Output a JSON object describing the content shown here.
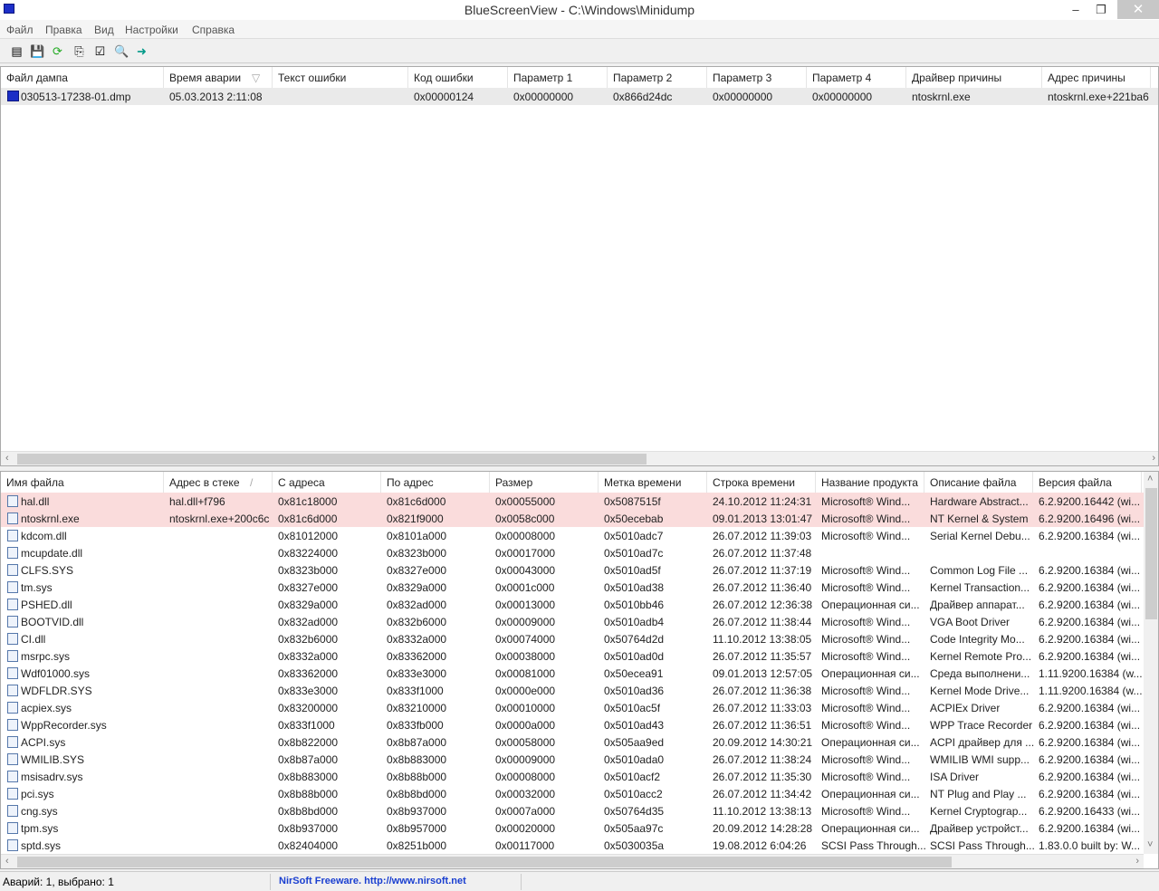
{
  "window": {
    "title": "BlueScreenView  -  C:\\Windows\\Minidump",
    "minimize": "‒",
    "maximize": "❐",
    "close": "✕"
  },
  "menu": [
    "Файл",
    "Правка",
    "Вид",
    "Настройки",
    "Справка"
  ],
  "toolbar": [
    "properties-icon",
    "save-icon",
    "refresh-icon",
    "copy-icon",
    "options-icon",
    "find-icon",
    "exit-icon"
  ],
  "dumps": {
    "columns": [
      "Файл дампа",
      "Время аварии",
      "Текст ошибки",
      "Код ошибки",
      "Параметр 1",
      "Параметр 2",
      "Параметр 3",
      "Параметр 4",
      "Драйвер причины",
      "Адрес причины"
    ],
    "rows": [
      [
        "030513-17238-01.dmp",
        "05.03.2013 2:11:08",
        "",
        "0x00000124",
        "0x00000000",
        "0x866d24dc",
        "0x00000000",
        "0x00000000",
        "ntoskrnl.exe",
        "ntoskrnl.exe+221ba6"
      ]
    ]
  },
  "drivers": {
    "columns": [
      "Имя файла",
      "Адрес в стеке",
      "С адреса",
      "По адрес",
      "Размер",
      "Метка времени",
      "Строка времени",
      "Название продукта",
      "Описание файла",
      "Версия файла"
    ],
    "rows": [
      [
        "hal.dll",
        "hal.dll+f796",
        "0x81c18000",
        "0x81c6d000",
        "0x00055000",
        "0x5087515f",
        "24.10.2012 11:24:31",
        "Microsoft® Wind...",
        "Hardware Abstract...",
        "6.2.9200.16442 (wi..."
      ],
      [
        "ntoskrnl.exe",
        "ntoskrnl.exe+200c6c",
        "0x81c6d000",
        "0x821f9000",
        "0x0058c000",
        "0x50ecebab",
        "09.01.2013 13:01:47",
        "Microsoft® Wind...",
        "NT Kernel & System",
        "6.2.9200.16496 (wi..."
      ],
      [
        "kdcom.dll",
        "",
        "0x81012000",
        "0x8101a000",
        "0x00008000",
        "0x5010adc7",
        "26.07.2012 11:39:03",
        "Microsoft® Wind...",
        "Serial Kernel Debu...",
        "6.2.9200.16384 (wi..."
      ],
      [
        "mcupdate.dll",
        "",
        "0x83224000",
        "0x8323b000",
        "0x00017000",
        "0x5010ad7c",
        "26.07.2012 11:37:48",
        "",
        "",
        ""
      ],
      [
        "CLFS.SYS",
        "",
        "0x8323b000",
        "0x8327e000",
        "0x00043000",
        "0x5010ad5f",
        "26.07.2012 11:37:19",
        "Microsoft® Wind...",
        "Common Log File ...",
        "6.2.9200.16384 (wi..."
      ],
      [
        "tm.sys",
        "",
        "0x8327e000",
        "0x8329a000",
        "0x0001c000",
        "0x5010ad38",
        "26.07.2012 11:36:40",
        "Microsoft® Wind...",
        "Kernel Transaction...",
        "6.2.9200.16384 (wi..."
      ],
      [
        "PSHED.dll",
        "",
        "0x8329a000",
        "0x832ad000",
        "0x00013000",
        "0x5010bb46",
        "26.07.2012 12:36:38",
        "Операционная си...",
        "Драйвер аппарат...",
        "6.2.9200.16384 (wi..."
      ],
      [
        "BOOTVID.dll",
        "",
        "0x832ad000",
        "0x832b6000",
        "0x00009000",
        "0x5010adb4",
        "26.07.2012 11:38:44",
        "Microsoft® Wind...",
        "VGA Boot Driver",
        "6.2.9200.16384 (wi..."
      ],
      [
        "CI.dll",
        "",
        "0x832b6000",
        "0x8332a000",
        "0x00074000",
        "0x50764d2d",
        "11.10.2012 13:38:05",
        "Microsoft® Wind...",
        "Code Integrity Mo...",
        "6.2.9200.16384 (wi..."
      ],
      [
        "msrpc.sys",
        "",
        "0x8332a000",
        "0x83362000",
        "0x00038000",
        "0x5010ad0d",
        "26.07.2012 11:35:57",
        "Microsoft® Wind...",
        "Kernel Remote Pro...",
        "6.2.9200.16384 (wi..."
      ],
      [
        "Wdf01000.sys",
        "",
        "0x83362000",
        "0x833e3000",
        "0x00081000",
        "0x50ecea91",
        "09.01.2013 12:57:05",
        "Операционная си...",
        "Среда выполнени...",
        "1.11.9200.16384 (w..."
      ],
      [
        "WDFLDR.SYS",
        "",
        "0x833e3000",
        "0x833f1000",
        "0x0000e000",
        "0x5010ad36",
        "26.07.2012 11:36:38",
        "Microsoft® Wind...",
        "Kernel Mode Drive...",
        "1.11.9200.16384 (w..."
      ],
      [
        "acpiex.sys",
        "",
        "0x83200000",
        "0x83210000",
        "0x00010000",
        "0x5010ac5f",
        "26.07.2012 11:33:03",
        "Microsoft® Wind...",
        "ACPIEx Driver",
        "6.2.9200.16384 (wi..."
      ],
      [
        "WppRecorder.sys",
        "",
        "0x833f1000",
        "0x833fb000",
        "0x0000a000",
        "0x5010ad43",
        "26.07.2012 11:36:51",
        "Microsoft® Wind...",
        "WPP Trace Recorder",
        "6.2.9200.16384 (wi..."
      ],
      [
        "ACPI.sys",
        "",
        "0x8b822000",
        "0x8b87a000",
        "0x00058000",
        "0x505aa9ed",
        "20.09.2012 14:30:21",
        "Операционная си...",
        "ACPI драйвер для ...",
        "6.2.9200.16384 (wi..."
      ],
      [
        "WMILIB.SYS",
        "",
        "0x8b87a000",
        "0x8b883000",
        "0x00009000",
        "0x5010ada0",
        "26.07.2012 11:38:24",
        "Microsoft® Wind...",
        "WMILIB WMI supp...",
        "6.2.9200.16384 (wi..."
      ],
      [
        "msisadrv.sys",
        "",
        "0x8b883000",
        "0x8b88b000",
        "0x00008000",
        "0x5010acf2",
        "26.07.2012 11:35:30",
        "Microsoft® Wind...",
        "ISA Driver",
        "6.2.9200.16384 (wi..."
      ],
      [
        "pci.sys",
        "",
        "0x8b88b000",
        "0x8b8bd000",
        "0x00032000",
        "0x5010acc2",
        "26.07.2012 11:34:42",
        "Операционная си...",
        "NT Plug and Play ...",
        "6.2.9200.16384 (wi..."
      ],
      [
        "cng.sys",
        "",
        "0x8b8bd000",
        "0x8b937000",
        "0x0007a000",
        "0x50764d35",
        "11.10.2012 13:38:13",
        "Microsoft® Wind...",
        "Kernel Cryptograp...",
        "6.2.9200.16433 (wi..."
      ],
      [
        "tpm.sys",
        "",
        "0x8b937000",
        "0x8b957000",
        "0x00020000",
        "0x505aa97c",
        "20.09.2012 14:28:28",
        "Операционная си...",
        "Драйвер устройст...",
        "6.2.9200.16384 (wi..."
      ],
      [
        "sptd.sys",
        "",
        "0x82404000",
        "0x8251b000",
        "0x00117000",
        "0x5030035a",
        "19.08.2012 6:04:26",
        "SCSI Pass Through...",
        "SCSI Pass Through...",
        "1.83.0.0 built by: W..."
      ]
    ]
  },
  "status": {
    "count": "Аварий: 1, выбрано: 1",
    "link": "NirSoft Freeware.  http://www.nirsoft.net"
  }
}
